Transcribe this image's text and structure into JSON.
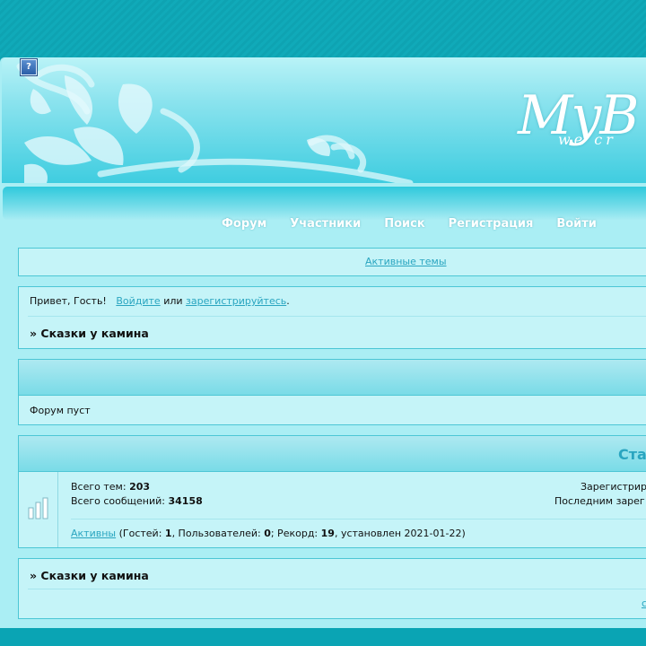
{
  "header": {
    "logo_text": "MyB",
    "logo_sub": "we cr",
    "help_label": "?"
  },
  "nav": {
    "items": [
      "Форум",
      "Участники",
      "Поиск",
      "Регистрация",
      "Войти"
    ]
  },
  "active_topics_link": "Активные темы",
  "greeting": {
    "prefix": "Привет, Гость!",
    "login": "Войдите",
    "or": "или",
    "register": "зарегистрируйтесь",
    "suffix": "."
  },
  "breadcrumb": "» Сказки у камина",
  "forum": {
    "empty_text": "Форум пуст"
  },
  "stats": {
    "title": "Ста",
    "topics_label": "Всего тем:",
    "topics_value": "203",
    "posts_label": "Всего сообщений:",
    "posts_value": "34158",
    "registered_label": "Зарегистрир",
    "last_registered_label": "Последним зарег",
    "active_link": "Активны",
    "guests_label": "(Гостей:",
    "guests_value": "1",
    "users_label": ", Пользователей:",
    "users_value": "0",
    "record_label": "; Рекорд:",
    "record_value": "19",
    "record_date": ", установлен 2021-01-22)"
  },
  "bottom": {
    "breadcrumb": "» Сказки у камина",
    "cut_link": "с"
  },
  "colors": {
    "accent": "#2aa5c0",
    "page_bg": "#aaeef4",
    "outer_bg": "#10aab9"
  }
}
